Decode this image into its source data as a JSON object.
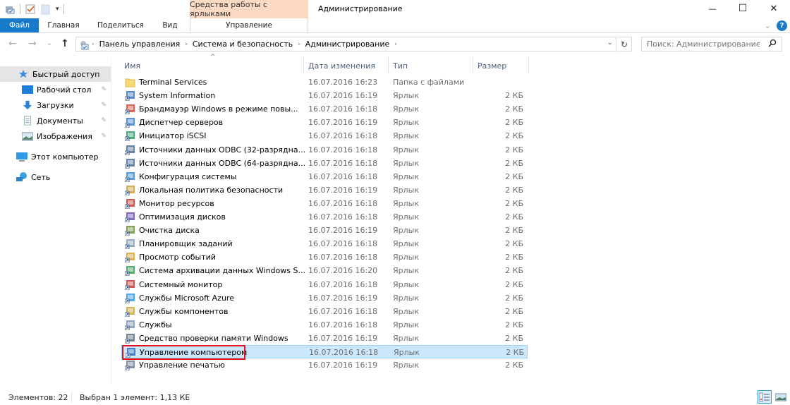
{
  "window": {
    "title": "Администрирование",
    "context_tab": "Средства работы с ярлыками",
    "controls": {
      "minimize": "—",
      "maximize": "☐",
      "close": "✕"
    }
  },
  "quick_access_toolbar": {
    "icons": [
      "properties-icon",
      "checkmark-document-icon",
      "new-folder-icon",
      "customize-dropdown-icon"
    ]
  },
  "ribbon": {
    "tabs": [
      {
        "label": "Файл",
        "active": true
      },
      {
        "label": "Главная"
      },
      {
        "label": "Поделиться"
      },
      {
        "label": "Вид"
      },
      {
        "label": "Управление"
      }
    ],
    "collapse_glyph": "⌄",
    "help_glyph": "?"
  },
  "navigation": {
    "back": "←",
    "forward": "→",
    "recent": "⌄",
    "up": "↑",
    "breadcrumb": [
      "Панель управления",
      "Система и безопасность",
      "Администрирование"
    ],
    "breadcrumb_sep": "›",
    "dropdown": "⌄",
    "refresh": "↻",
    "search_placeholder": "Поиск: Администрирование",
    "search_glyph": "⚲"
  },
  "sidebar": {
    "items": [
      {
        "label": "Быстрый доступ",
        "icon": "star-icon",
        "active": true
      },
      {
        "label": "Рабочий стол",
        "icon": "desktop-icon",
        "pinned": true
      },
      {
        "label": "Загрузки",
        "icon": "download-arrow-icon",
        "pinned": true
      },
      {
        "label": "Документы",
        "icon": "documents-icon",
        "pinned": true
      },
      {
        "label": "Изображения",
        "icon": "pictures-icon",
        "pinned": true
      },
      {
        "label": "Этот компьютер",
        "icon": "computer-icon"
      },
      {
        "label": "Сеть",
        "icon": "network-icon"
      }
    ],
    "pin_glyph": "📌"
  },
  "file_list": {
    "columns": [
      "Имя",
      "Дата изменения",
      "Тип",
      "Размер"
    ],
    "sort_glyph": "^",
    "rows": [
      {
        "name": "Terminal Services",
        "date": "16.07.2016 16:23",
        "type": "Папка с файлами",
        "size": "",
        "icon": "folder-icon"
      },
      {
        "name": "System Information",
        "date": "16.07.2016 16:19",
        "type": "Ярлык",
        "size": "2 КБ",
        "icon": "system-information-icon"
      },
      {
        "name": "Брандмауэр Windows в режиме повы...",
        "date": "16.07.2016 16:18",
        "type": "Ярлык",
        "size": "2 КБ",
        "icon": "firewall-icon"
      },
      {
        "name": "Диспетчер серверов",
        "date": "16.07.2016 16:19",
        "type": "Ярлык",
        "size": "2 КБ",
        "icon": "server-manager-icon"
      },
      {
        "name": "Инициатор iSCSI",
        "date": "16.07.2016 16:18",
        "type": "Ярлык",
        "size": "2 КБ",
        "icon": "iscsi-icon"
      },
      {
        "name": "Источники данных ODBC (32-разрядна...",
        "date": "16.07.2016 16:18",
        "type": "Ярлык",
        "size": "2 КБ",
        "icon": "odbc-icon"
      },
      {
        "name": "Источники данных ODBC (64-разрядна...",
        "date": "16.07.2016 16:18",
        "type": "Ярлык",
        "size": "2 КБ",
        "icon": "odbc-icon"
      },
      {
        "name": "Конфигурация системы",
        "date": "16.07.2016 16:18",
        "type": "Ярлык",
        "size": "2 КБ",
        "icon": "msconfig-icon"
      },
      {
        "name": "Локальная политика безопасности",
        "date": "16.07.2016 16:19",
        "type": "Ярлык",
        "size": "2 КБ",
        "icon": "security-policy-icon"
      },
      {
        "name": "Монитор ресурсов",
        "date": "16.07.2016 16:18",
        "type": "Ярлык",
        "size": "2 КБ",
        "icon": "resource-monitor-icon"
      },
      {
        "name": "Оптимизация дисков",
        "date": "16.07.2016 16:18",
        "type": "Ярлык",
        "size": "2 КБ",
        "icon": "defrag-icon"
      },
      {
        "name": "Очистка диска",
        "date": "16.07.2016 16:19",
        "type": "Ярлык",
        "size": "2 КБ",
        "icon": "disk-cleanup-icon"
      },
      {
        "name": "Планировщик заданий",
        "date": "16.07.2016 16:18",
        "type": "Ярлык",
        "size": "2 КБ",
        "icon": "task-scheduler-icon"
      },
      {
        "name": "Просмотр событий",
        "date": "16.07.2016 16:18",
        "type": "Ярлык",
        "size": "2 КБ",
        "icon": "event-viewer-icon"
      },
      {
        "name": "Система архивации данных Windows S...",
        "date": "16.07.2016 16:20",
        "type": "Ярлык",
        "size": "2 КБ",
        "icon": "backup-icon"
      },
      {
        "name": "Системный монитор",
        "date": "16.07.2016 16:18",
        "type": "Ярлык",
        "size": "2 КБ",
        "icon": "performance-monitor-icon"
      },
      {
        "name": "Службы Microsoft Azure",
        "date": "16.07.2016 16:19",
        "type": "Ярлык",
        "size": "2 КБ",
        "icon": "azure-icon"
      },
      {
        "name": "Службы компонентов",
        "date": "16.07.2016 16:18",
        "type": "Ярлык",
        "size": "2 КБ",
        "icon": "component-services-icon"
      },
      {
        "name": "Службы",
        "date": "16.07.2016 16:18",
        "type": "Ярлык",
        "size": "2 КБ",
        "icon": "services-icon"
      },
      {
        "name": "Средство проверки памяти Windows",
        "date": "16.07.2016 16:19",
        "type": "Ярлык",
        "size": "2 КБ",
        "icon": "memory-diagnostic-icon"
      },
      {
        "name": "Управление компьютером",
        "date": "16.07.2016 16:18",
        "type": "Ярлык",
        "size": "2 КБ",
        "icon": "computer-management-icon",
        "selected": true
      },
      {
        "name": "Управление печатью",
        "date": "16.07.2016 16:19",
        "type": "Ярлык",
        "size": "2 КБ",
        "icon": "print-management-icon"
      }
    ]
  },
  "status_bar": {
    "items_count": "Элементов: 22",
    "selection": "Выбран 1 элемент: 1,13 КБ"
  },
  "colors": {
    "file_tab": "#1979ca",
    "context_tab": "#fcd9c3",
    "selection_bg": "#cce8ff",
    "selection_border": "#99d1ff",
    "highlight_box": "#e3131b",
    "sidebar_active": "#e5e5e5"
  }
}
